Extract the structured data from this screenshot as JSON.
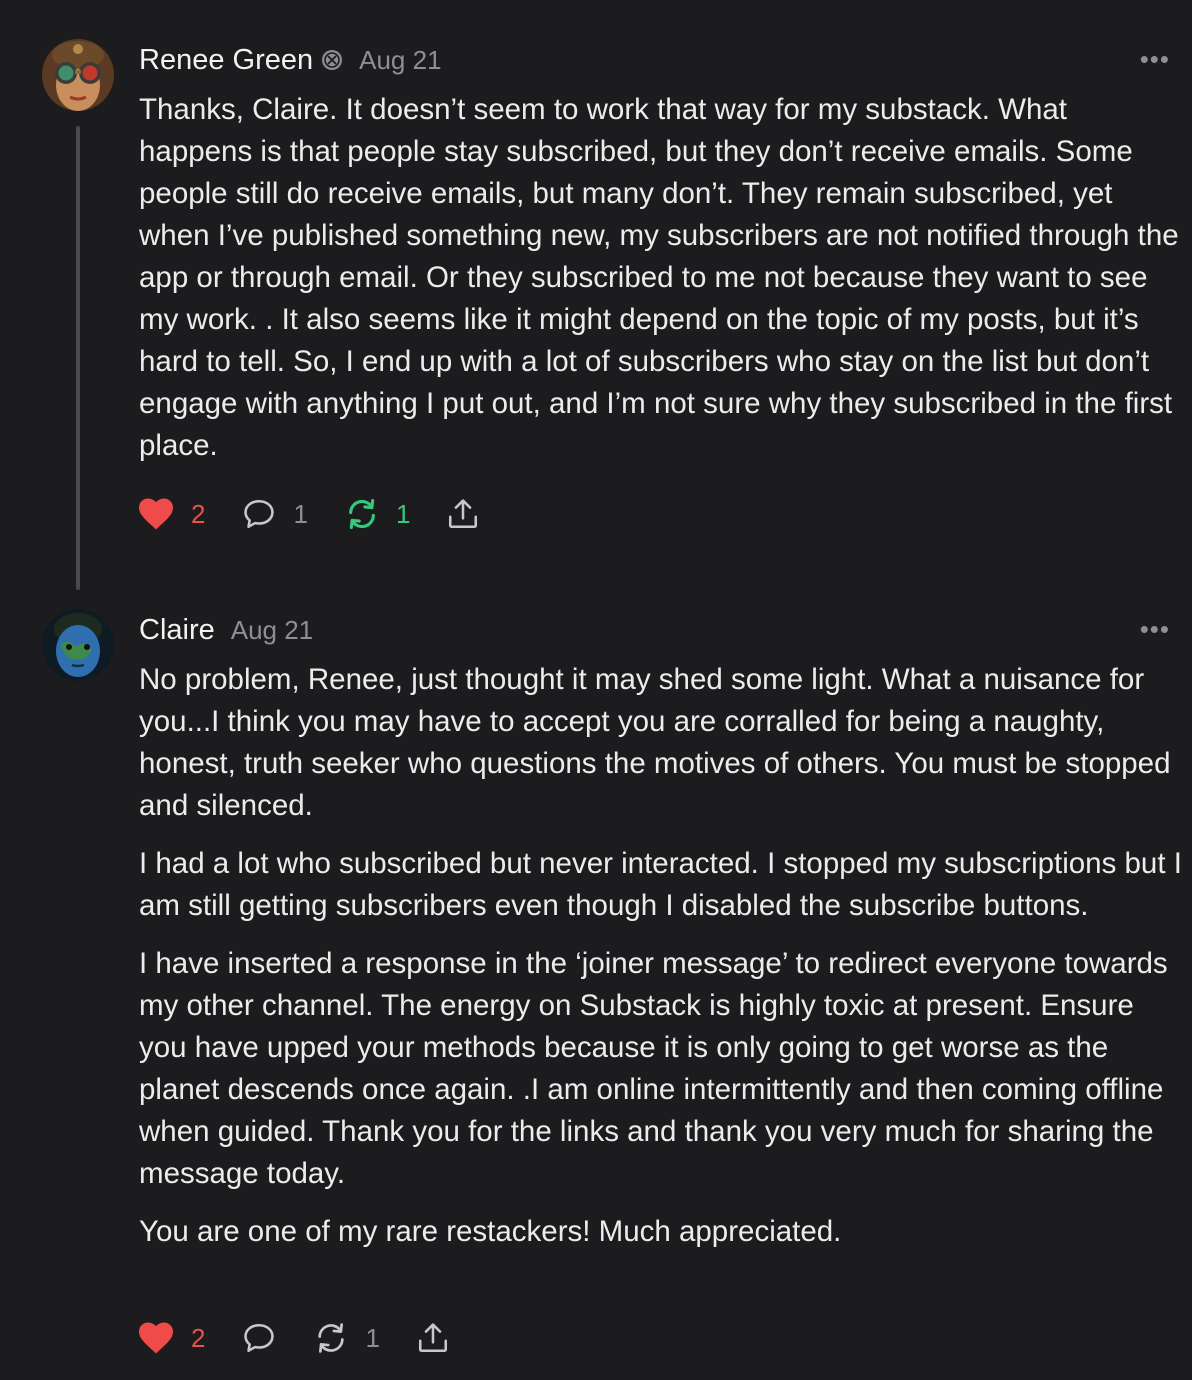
{
  "comments": [
    {
      "author": "Renee Green",
      "date": "Aug 21",
      "badge_icon": "founding-badge-icon",
      "paragraphs": [
        "Thanks, Claire. It doesn’t seem to work that way for my substack. What happens is that people stay subscribed, but they don’t receive emails. Some people still do receive emails, but many don’t. They remain subscribed, yet when I’ve published something new, my subscribers are not notified through the app or through email. Or they subscribed to me not because they want to see my work. . It also seems like it might depend on the topic of my posts, but it’s hard to tell. So, I end up with a lot of subscribers who stay on the list but don’t engage with anything I put out, and I’m not sure why they subscribed in the first place."
      ],
      "likes": "2",
      "replies": "1",
      "restacks": "1",
      "restacked": true
    },
    {
      "author": "Claire",
      "date": "Aug 21",
      "paragraphs": [
        "No problem, Renee, just thought it may shed some light. What a nuisance for you...I think you may have to accept you are corralled for being a naughty, honest, truth seeker who questions the motives of others. You must be stopped and silenced.",
        "I had a lot who subscribed but never interacted. I stopped my subscriptions but I am still getting subscribers even though I disabled the subscribe buttons.",
        "I have inserted a response in the ‘joiner message’ to redirect everyone towards my other channel. The energy on Substack is highly toxic at present. Ensure you have upped your methods because it is only going to get worse as the planet descends once again. .I am online intermittently and then coming offline when guided. Thank you for the links and thank you very much for sharing the message today.",
        "You are one of my rare restackers! Much appreciated."
      ],
      "likes": "2",
      "replies": "",
      "restacks": "1",
      "restacked": false
    }
  ],
  "more_label": "•••",
  "colors": {
    "background": "#1c1c1e",
    "like": "#ef4b4b",
    "restack_active": "#34c97b",
    "muted": "#8e8e93"
  }
}
